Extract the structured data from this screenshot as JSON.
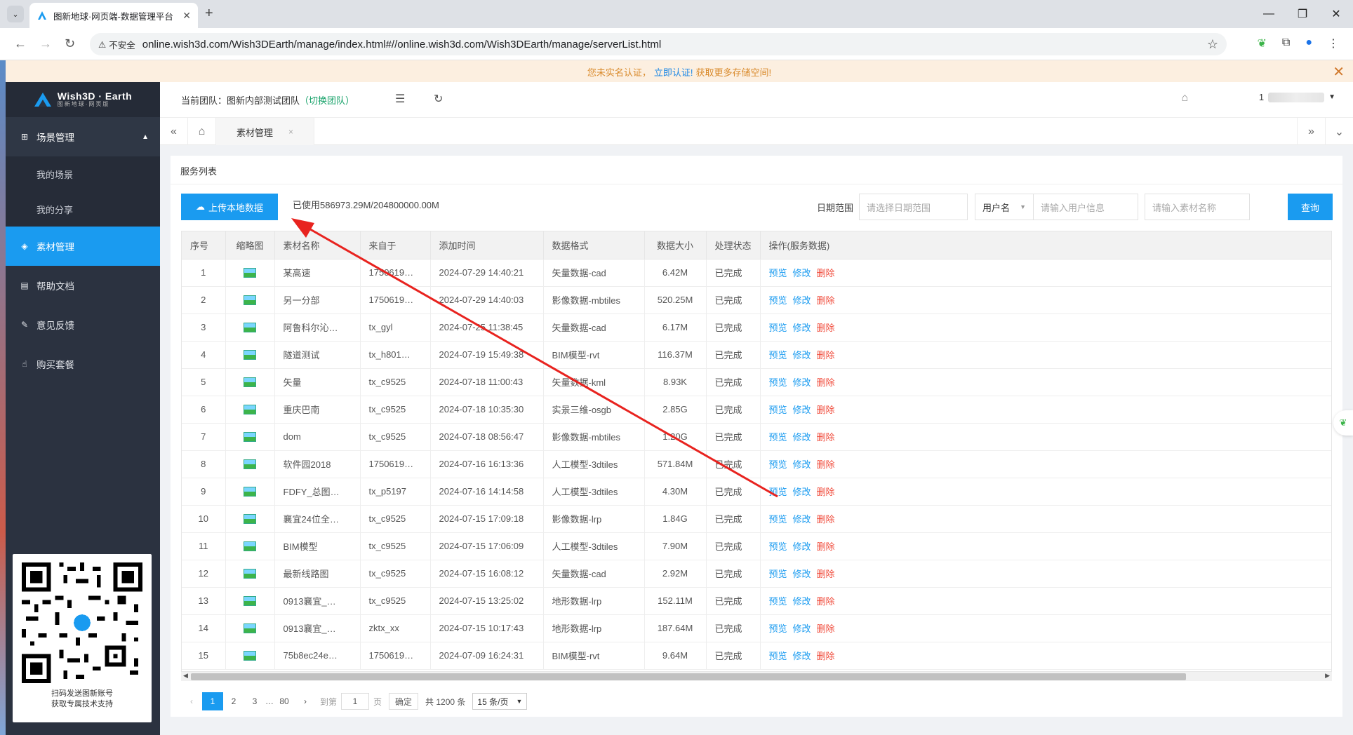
{
  "browser": {
    "tab_title": "图新地球·网页端-数据管理平台",
    "insecure_label": "不安全",
    "url": "online.wish3d.com/Wish3DEarth/manage/index.html#//online.wish3d.com/Wish3DEarth/manage/serverList.html"
  },
  "notice": {
    "prefix": "您未实名认证，",
    "link": "立即认证!",
    "suffix": "获取更多存储空间!"
  },
  "sidebar": {
    "logo_title": "Wish3D · Earth",
    "logo_sub": "图新地球·网页版",
    "group_label": "场景管理",
    "sub_items": [
      "我的场景",
      "我的分享"
    ],
    "items": [
      {
        "label": "素材管理",
        "icon": "layers-icon",
        "active": true
      },
      {
        "label": "帮助文档",
        "icon": "book-icon",
        "active": false
      },
      {
        "label": "意见反馈",
        "icon": "feedback-icon",
        "active": false
      },
      {
        "label": "购买套餐",
        "icon": "hand-icon",
        "active": false
      }
    ],
    "qr_line1": "扫码发送图新账号",
    "qr_line2": "获取专属技术支持"
  },
  "header": {
    "team_label": "当前团队：图新内部测试团队",
    "team_switch": "（切换团队）",
    "user_prefix": "1"
  },
  "tabs": {
    "active": "素材管理"
  },
  "main": {
    "title": "服务列表",
    "upload_label": "上传本地数据",
    "usage": "已使用586973.29M/204800000.00M",
    "date_label": "日期范围",
    "date_placeholder": "请选择日期范围",
    "user_select": "用户名",
    "user_placeholder": "请输入用户信息",
    "name_placeholder": "请输入素材名称",
    "query_label": "查询"
  },
  "table": {
    "columns": [
      "序号",
      "缩略图",
      "素材名称",
      "来自于",
      "添加时间",
      "数据格式",
      "数据大小",
      "处理状态",
      "操作(服务数据)"
    ],
    "ops": {
      "preview": "预览",
      "edit": "修改",
      "delete": "删除"
    },
    "rows": [
      {
        "no": "1",
        "name": "某高速",
        "from": "1750619…",
        "time": "2024-07-29 14:40:21",
        "format": "矢量数据-cad",
        "size": "6.42M",
        "status": "已完成"
      },
      {
        "no": "2",
        "name": "另一分部",
        "from": "1750619…",
        "time": "2024-07-29 14:40:03",
        "format": "影像数据-mbtiles",
        "size": "520.25M",
        "status": "已完成"
      },
      {
        "no": "3",
        "name": "阿鲁科尔沁…",
        "from": "tx_gyl",
        "time": "2024-07-25 11:38:45",
        "format": "矢量数据-cad",
        "size": "6.17M",
        "status": "已完成"
      },
      {
        "no": "4",
        "name": "隧道测试",
        "from": "tx_h801…",
        "time": "2024-07-19 15:49:38",
        "format": "BIM模型-rvt",
        "size": "116.37M",
        "status": "已完成"
      },
      {
        "no": "5",
        "name": "矢量",
        "from": "tx_c9525",
        "time": "2024-07-18 11:00:43",
        "format": "矢量数据-kml",
        "size": "8.93K",
        "status": "已完成"
      },
      {
        "no": "6",
        "name": "重庆巴南",
        "from": "tx_c9525",
        "time": "2024-07-18 10:35:30",
        "format": "实景三维-osgb",
        "size": "2.85G",
        "status": "已完成"
      },
      {
        "no": "7",
        "name": "dom",
        "from": "tx_c9525",
        "time": "2024-07-18 08:56:47",
        "format": "影像数据-mbtiles",
        "size": "1.20G",
        "status": "已完成"
      },
      {
        "no": "8",
        "name": "软件园2018",
        "from": "1750619…",
        "time": "2024-07-16 16:13:36",
        "format": "人工模型-3dtiles",
        "size": "571.84M",
        "status": "已完成"
      },
      {
        "no": "9",
        "name": "FDFY_总图…",
        "from": "tx_p5197",
        "time": "2024-07-16 14:14:58",
        "format": "人工模型-3dtiles",
        "size": "4.30M",
        "status": "已完成"
      },
      {
        "no": "10",
        "name": "襄宜24位全…",
        "from": "tx_c9525",
        "time": "2024-07-15 17:09:18",
        "format": "影像数据-lrp",
        "size": "1.84G",
        "status": "已完成"
      },
      {
        "no": "11",
        "name": "BIM模型",
        "from": "tx_c9525",
        "time": "2024-07-15 17:06:09",
        "format": "人工模型-3dtiles",
        "size": "7.90M",
        "status": "已完成"
      },
      {
        "no": "12",
        "name": "最新线路图",
        "from": "tx_c9525",
        "time": "2024-07-15 16:08:12",
        "format": "矢量数据-cad",
        "size": "2.92M",
        "status": "已完成"
      },
      {
        "no": "13",
        "name": "0913襄宜_…",
        "from": "tx_c9525",
        "time": "2024-07-15 13:25:02",
        "format": "地形数据-lrp",
        "size": "152.11M",
        "status": "已完成"
      },
      {
        "no": "14",
        "name": "0913襄宜_…",
        "from": "zktx_xx",
        "time": "2024-07-15 10:17:43",
        "format": "地形数据-lrp",
        "size": "187.64M",
        "status": "已完成"
      },
      {
        "no": "15",
        "name": "75b8ec24e…",
        "from": "1750619…",
        "time": "2024-07-09 16:24:31",
        "format": "BIM模型-rvt",
        "size": "9.64M",
        "status": "已完成"
      }
    ]
  },
  "pager": {
    "pages": [
      "1",
      "2",
      "3"
    ],
    "ellipsis": "…",
    "last": "80",
    "goto_label": "到第",
    "goto_value": "1",
    "page_unit": "页",
    "ok_label": "确定",
    "total": "共 1200 条",
    "per_page": "15 条/页"
  }
}
